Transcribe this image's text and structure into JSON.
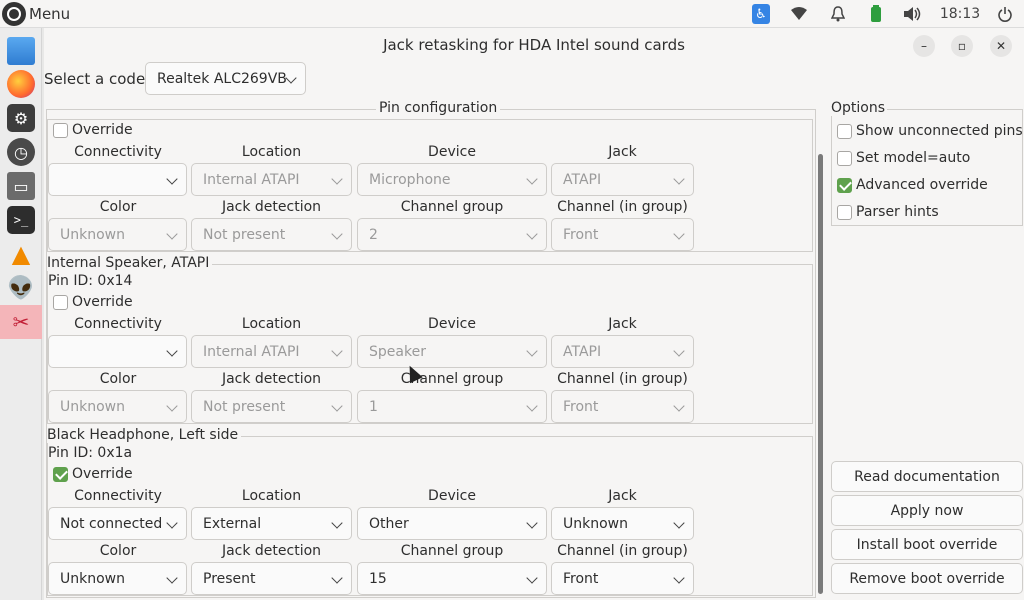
{
  "topbar": {
    "menu_label": "Menu",
    "clock": "18:13",
    "icons": [
      "accessibility-icon",
      "wifi-icon",
      "bell-icon",
      "battery-icon",
      "volume-icon",
      "power-icon"
    ]
  },
  "dock": {
    "items": [
      "desktop-icon",
      "firefox-icon",
      "settings-icon",
      "clock-icon",
      "files-icon",
      "terminal-icon",
      "vlc-icon",
      "alien-icon",
      "jack-retask-icon"
    ]
  },
  "window": {
    "title": "Jack retasking for HDA Intel sound cards",
    "codec_label": "Select a codec:",
    "codec_value": "Realtek ALC269VB"
  },
  "pin_config": {
    "title": "Pin configuration",
    "headers": {
      "connectivity": "Connectivity",
      "location": "Location",
      "device": "Device",
      "jack": "Jack",
      "color": "Color",
      "jack_detection": "Jack detection",
      "channel_group": "Channel group",
      "channel_in_group": "Channel (in group)"
    },
    "override_label": "Override",
    "sections": [
      {
        "title": "",
        "pin_id": "",
        "override": false,
        "connectivity": "",
        "location": "Internal ATAPI",
        "device": "Microphone",
        "jack": "ATAPI",
        "color": "Unknown",
        "jack_detection": "Not present",
        "channel_group": "2",
        "channel_in_group": "Front"
      },
      {
        "title": "Internal Speaker, ATAPI",
        "pin_id": "Pin ID: 0x14",
        "override": false,
        "connectivity": "",
        "location": "Internal ATAPI",
        "device": "Speaker",
        "jack": "ATAPI",
        "color": "Unknown",
        "jack_detection": "Not present",
        "channel_group": "1",
        "channel_in_group": "Front"
      },
      {
        "title": "Black Headphone, Left side",
        "pin_id": "Pin ID: 0x1a",
        "override": true,
        "connectivity": "Not connected",
        "location": "External",
        "device": "Other",
        "jack": "Unknown",
        "color": "Unknown",
        "jack_detection": "Present",
        "channel_group": "15",
        "channel_in_group": "Front"
      }
    ]
  },
  "options": {
    "title": "Options",
    "items": [
      {
        "label": "Show unconnected pins",
        "checked": false
      },
      {
        "label": "Set model=auto",
        "checked": false
      },
      {
        "label": "Advanced override",
        "checked": true
      },
      {
        "label": "Parser hints",
        "checked": false
      }
    ]
  },
  "buttons": {
    "read_docs": "Read documentation",
    "apply_now": "Apply now",
    "install_boot": "Install boot override",
    "remove_boot": "Remove boot override"
  },
  "colors": {
    "accent_green": "#5fa14d",
    "a11y_blue": "#3584e4",
    "active_dock": "#f4b5b9"
  }
}
